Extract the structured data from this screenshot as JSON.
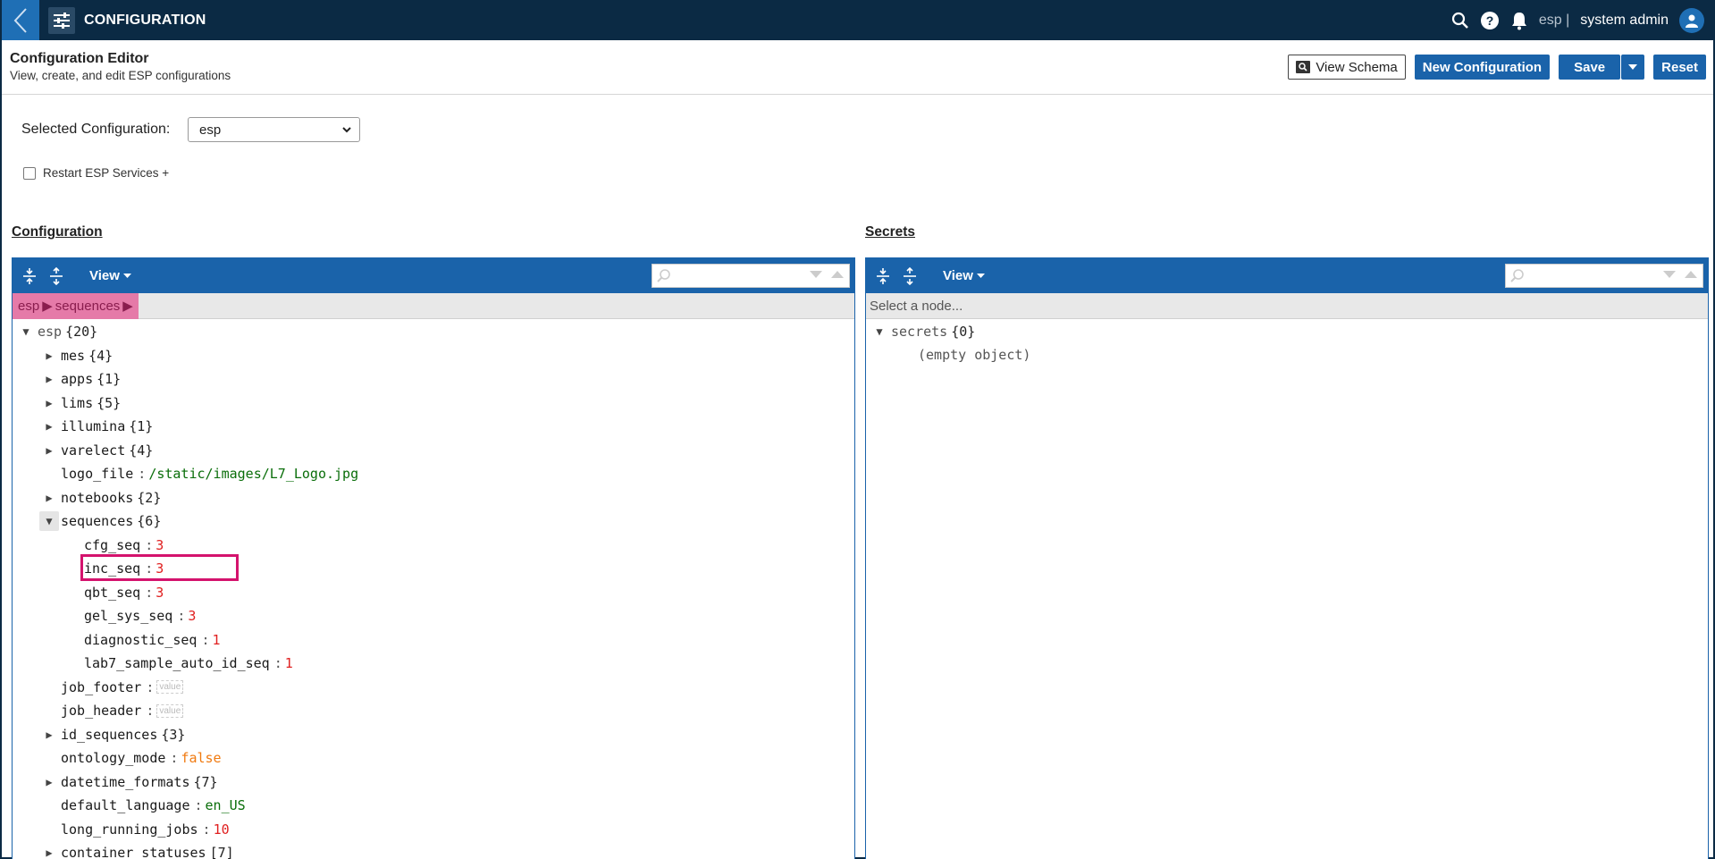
{
  "topbar": {
    "title": "CONFIGURATION",
    "tenant": "esp |",
    "user": "system admin"
  },
  "header": {
    "title": "Configuration Editor",
    "subtitle": "View, create, and edit ESP configurations",
    "buttons": {
      "view_schema": "View Schema",
      "new_configuration": "New Configuration",
      "save": "Save",
      "reset": "Reset"
    }
  },
  "form": {
    "selected_label": "Selected Configuration:",
    "selected_value": "esp",
    "restart_label": "Restart ESP Services +"
  },
  "configuration": {
    "section_title": "Configuration",
    "view_label": "View",
    "breadcrumb": [
      "esp",
      "sequences"
    ],
    "tree": [
      {
        "key": "esp",
        "count": "{20}",
        "toggle": "open",
        "level": 0
      },
      {
        "key": "mes",
        "count": "{4}",
        "toggle": "closed",
        "level": 1
      },
      {
        "key": "apps",
        "count": "{1}",
        "toggle": "closed",
        "level": 1
      },
      {
        "key": "lims",
        "count": "{5}",
        "toggle": "closed",
        "level": 1
      },
      {
        "key": "illumina",
        "count": "{1}",
        "toggle": "closed",
        "level": 1
      },
      {
        "key": "varelect",
        "count": "{4}",
        "toggle": "closed",
        "level": 1
      },
      {
        "key": "logo_file",
        "value": "/static/images/L7_Logo.jpg",
        "vtype": "str",
        "level": 1
      },
      {
        "key": "notebooks",
        "count": "{2}",
        "toggle": "closed",
        "level": 1
      },
      {
        "key": "sequences",
        "count": "{6}",
        "toggle": "open-active",
        "level": 1
      },
      {
        "key": "cfg_seq",
        "value": "3",
        "vtype": "num",
        "level": 2
      },
      {
        "key": "inc_seq",
        "value": "3",
        "vtype": "num",
        "level": 2
      },
      {
        "key": "qbt_seq",
        "value": "3",
        "vtype": "num",
        "level": 2
      },
      {
        "key": "gel_sys_seq",
        "value": "3",
        "vtype": "num",
        "level": 2
      },
      {
        "key": "diagnostic_seq",
        "value": "1",
        "vtype": "num",
        "level": 2
      },
      {
        "key": "lab7_sample_auto_id_seq",
        "value": "1",
        "vtype": "num",
        "level": 2
      },
      {
        "key": "job_footer",
        "value": "value",
        "vtype": "empty",
        "level": 1
      },
      {
        "key": "job_header",
        "value": "value",
        "vtype": "empty",
        "level": 1
      },
      {
        "key": "id_sequences",
        "count": "{3}",
        "toggle": "closed",
        "level": 1
      },
      {
        "key": "ontology_mode",
        "value": "false",
        "vtype": "bool",
        "level": 1
      },
      {
        "key": "datetime_formats",
        "count": "{7}",
        "toggle": "closed",
        "level": 1
      },
      {
        "key": "default_language",
        "value": "en_US",
        "vtype": "str",
        "level": 1
      },
      {
        "key": "long_running_jobs",
        "value": "10",
        "vtype": "num",
        "level": 1
      },
      {
        "key": "container_statuses",
        "count": "[7]",
        "toggle": "closed",
        "level": 1
      }
    ]
  },
  "secrets": {
    "section_title": "Secrets",
    "view_label": "View",
    "nav_placeholder": "Select a node...",
    "root_key": "secrets",
    "root_count": "{0}",
    "empty_text": "(empty object)"
  },
  "colors": {
    "topbar": "#0b2a44",
    "primary": "#1a63aa",
    "highlight": "#d4136d",
    "breadcrumb": "#e57aa8"
  }
}
